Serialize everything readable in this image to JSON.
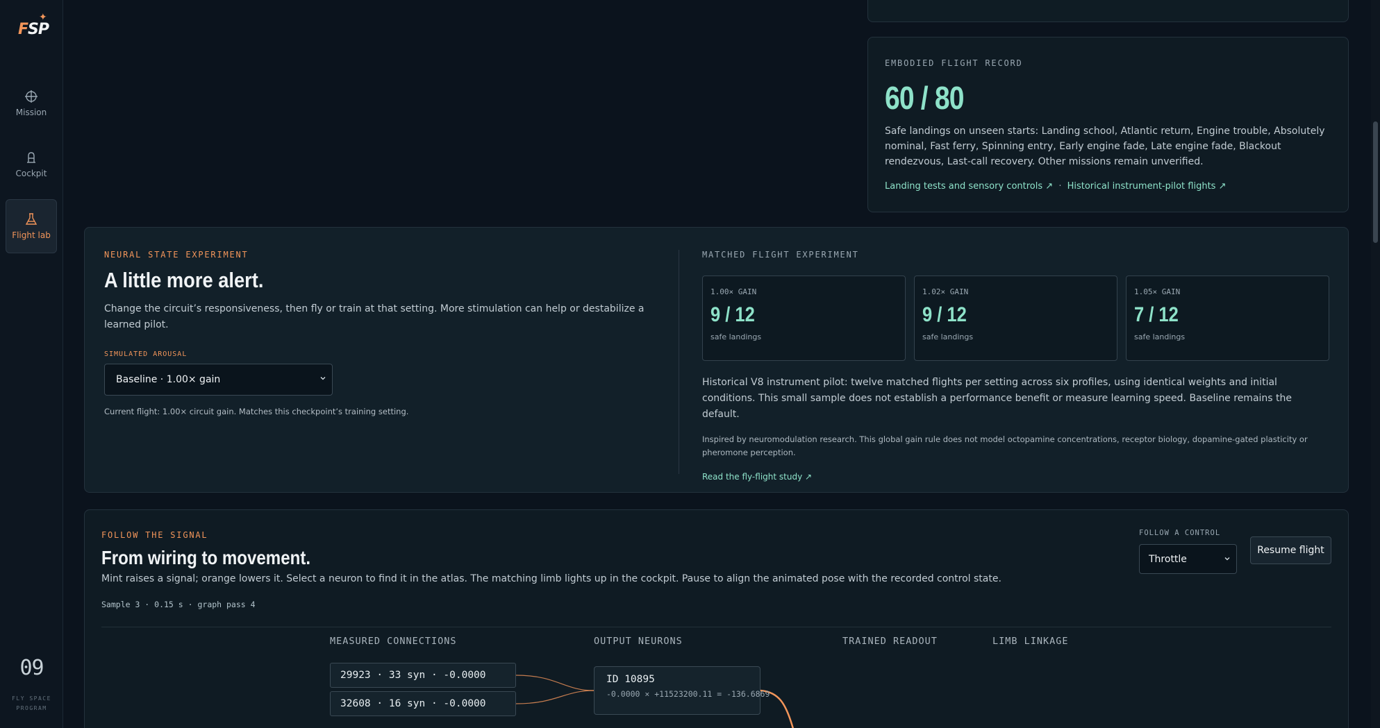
{
  "sidebar": {
    "logo_main": "SP",
    "logo_f": "F",
    "items": [
      {
        "label": "Mission",
        "icon": "crosshair-icon"
      },
      {
        "label": "Cockpit",
        "icon": "seat-icon"
      },
      {
        "label": "Flight lab",
        "icon": "flask-icon"
      }
    ],
    "number": "09",
    "program_line1": "FLY SPACE",
    "program_line2": "PROGRAM"
  },
  "record": {
    "eyebrow": "EMBODIED FLIGHT RECORD",
    "score": "60 / 80",
    "text": "Safe landings on unseen starts: Landing school, Atlantic return, Engine trouble, Absolutely nominal, Fast ferry, Spinning entry, Early engine fade, Late engine fade, Blackout rendezvous, Last-call recovery. Other missions remain unverified.",
    "link1": "Landing tests and sensory controls ↗",
    "separator": "·",
    "link2": "Historical instrument-pilot flights ↗"
  },
  "neural": {
    "eyebrow": "NEURAL STATE EXPERIMENT",
    "title": "A little more alert.",
    "description": "Change the circuit’s responsiveness, then fly or train at that setting. More stimulation can help or destabilize a learned pilot.",
    "arousal_label": "SIMULATED AROUSAL",
    "arousal_value": "Baseline · 1.00× gain",
    "current_flight": "Current flight: 1.00× circuit gain. Matches this checkpoint’s training setting."
  },
  "matched": {
    "eyebrow": "MATCHED FLIGHT EXPERIMENT",
    "cards": [
      {
        "gain": "1.00× GAIN",
        "value": "9 / 12",
        "sub": "safe landings"
      },
      {
        "gain": "1.02× GAIN",
        "value": "9 / 12",
        "sub": "safe landings"
      },
      {
        "gain": "1.05× GAIN",
        "value": "7 / 12",
        "sub": "safe landings"
      }
    ],
    "historical": "Historical V8 instrument pilot: twelve matched flights per setting across six profiles, using identical weights and initial conditions. This small sample does not establish a performance benefit or measure learning speed. Baseline remains the default.",
    "inspired": "Inspired by neuromodulation research. This global gain rule does not model octopamine concentrations, receptor biology, dopamine-gated plasticity or pheromone perception.",
    "read_link": "Read the fly-flight study ↗"
  },
  "signal": {
    "eyebrow": "FOLLOW THE SIGNAL",
    "title": "From wiring to movement.",
    "description": "Mint raises a signal; orange lowers it. Select a neuron to find it in the atlas. The matching limb lights up in the cockpit. Pause to align the animated pose with the recorded control state.",
    "sample": "Sample 3 · 0.15 s · graph pass 4",
    "follow_label": "FOLLOW A CONTROL",
    "follow_value": "Throttle",
    "resume_label": "Resume flight",
    "columns": [
      "MEASURED CONNECTIONS",
      "OUTPUT NEURONS",
      "TRAINED READOUT",
      "LIMB LINKAGE"
    ],
    "connections": [
      "29923 · 33 syn · -0.0000",
      "32608 · 16 syn · -0.0000"
    ],
    "neuron_id": "ID 10895",
    "neuron_eq": "-0.0000 × +11523200.11 = -136.6869"
  },
  "colors": {
    "mint": "#8ee2c9",
    "orange": "#f2955a",
    "background": "#0b131d"
  }
}
